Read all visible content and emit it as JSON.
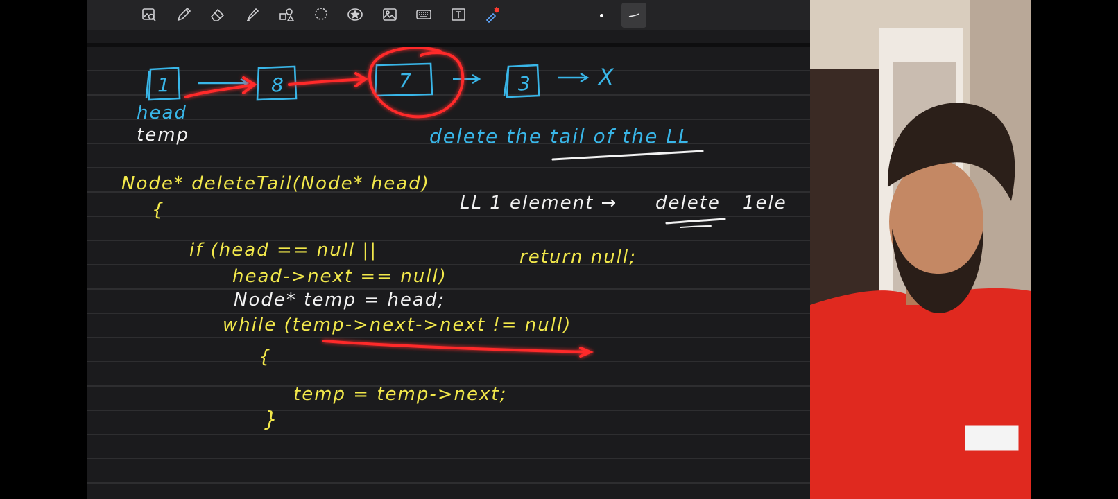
{
  "toolbar": {
    "tools": [
      {
        "icon": "image-search-icon"
      },
      {
        "icon": "pen-icon"
      },
      {
        "icon": "eraser-icon"
      },
      {
        "icon": "highlighter-icon"
      },
      {
        "icon": "shapes-icon"
      },
      {
        "icon": "lasso-icon"
      },
      {
        "icon": "star-sticker-icon"
      },
      {
        "icon": "image-icon"
      },
      {
        "icon": "keyboard-icon"
      },
      {
        "icon": "text-box-icon"
      },
      {
        "icon": "laser-pointer-icon"
      }
    ],
    "selected_stroke": "stroke-width-icon"
  },
  "whiteboard": {
    "list": {
      "nodes": [
        "1",
        "8",
        "7",
        "3"
      ],
      "null_mark": "X",
      "head_label": "head",
      "temp_label": "temp"
    },
    "title_note": "delete the tail of the LL",
    "side_note": {
      "text": "LL 1 element →",
      "emph": "delete",
      "tail": "1ele"
    },
    "code": {
      "signature": "Node* deleteTail(Node* head)",
      "open_brace": "{",
      "if_line": "if (head == null ||",
      "if_line2": "head->next == null)",
      "return_null": "return null;",
      "temp_decl": "Node* temp = head;",
      "while_line": "while (temp->next->next != null)",
      "while_open": "{",
      "advance": "temp = temp->next;",
      "close_brace": "}"
    }
  },
  "colors": {
    "ink_yellow": "#f2e84b",
    "ink_blue": "#39b6e8",
    "ink_white": "#f2f2f2",
    "laser_red": "#ff2b2b",
    "board_bg": "#1b1b1d"
  },
  "camera": {
    "overlay": "webcam-presenter"
  }
}
